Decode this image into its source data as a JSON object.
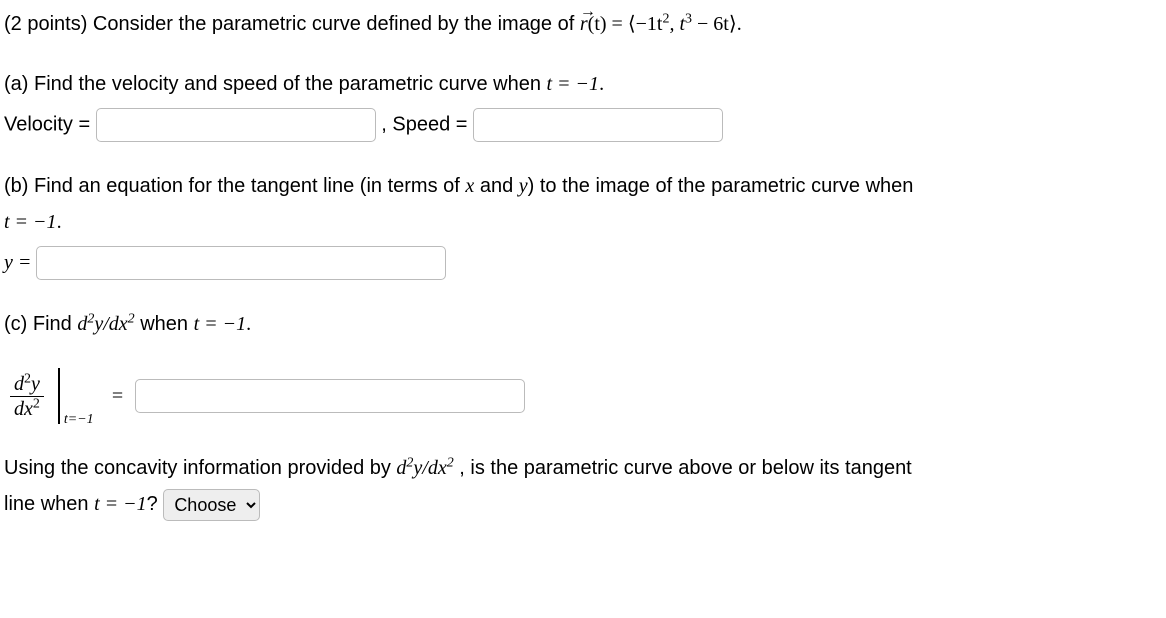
{
  "problem": {
    "points_prefix": "(2 points) Consider the parametric curve defined by the image of ",
    "r_of_t": "r",
    "r_arg": "(t) = ",
    "curve_expr_1": "−1t",
    "curve_expr_1_sup": "2",
    "curve_sep": ", t",
    "curve_expr_2_sup": "3",
    "curve_tail": " − 6t",
    "period": "."
  },
  "part_a": {
    "prompt_prefix": "(a) Find the velocity and speed of the parametric curve when ",
    "t_eq": "t = −1",
    "velocity_label": "Velocity = ",
    "comma": ",  ",
    "speed_label": "Speed = "
  },
  "part_b": {
    "prompt_line1_prefix": "(b) Find an equation for the tangent line (in terms of ",
    "x_var": "x",
    "and_word": " and ",
    "y_var": "y",
    "prompt_line1_suffix": ") to the image of the parametric curve when",
    "t_eq": "t = −1",
    "y_eq": "y = "
  },
  "part_c": {
    "prompt_prefix": "(c) Find ",
    "d2_num": "d",
    "d2_sup": "2",
    "d2_mid": "y/dx",
    "d2_sup2": "2",
    "prompt_mid": " when ",
    "t_eq": "t = −1",
    "eval_sub": "t=−1",
    "equals": "=",
    "frac_num_d": "d",
    "frac_num_sup": "2",
    "frac_num_y": "y",
    "frac_den_dx": "dx",
    "frac_den_sup": "2"
  },
  "concavity": {
    "prefix": "Using the concavity information provided by ",
    "suffix": " , is the parametric curve above or below its tangent",
    "line2_prefix": "line when ",
    "t_eq": "t = −1",
    "q_mark": "?",
    "dropdown_default": "Choose"
  }
}
